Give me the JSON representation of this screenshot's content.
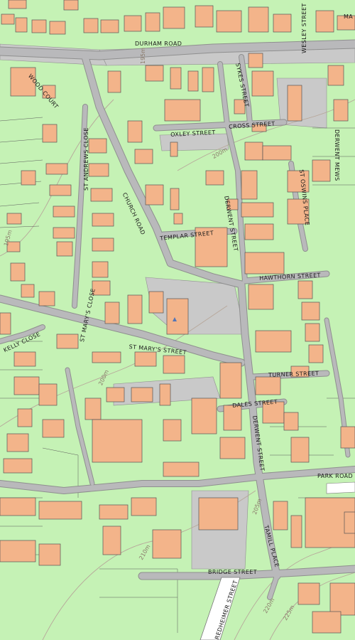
{
  "map": {
    "colors": {
      "land": "#c5f2b5",
      "road": "#b9b9bb",
      "building": "#f3b48a",
      "paved": "#c9c9c9",
      "contour": "#b7a79a",
      "marker": "#5575b5"
    },
    "streets": {
      "durham_road": "DURHAM ROAD",
      "wesley_street": "WESLEY STREET",
      "ma_partial": "MA",
      "oxley_street": "OXLEY STREET",
      "cross_street": "CROSS STREET",
      "sykes_street": "SYKES STREET",
      "derwent_mews": "DERWENT MEWS",
      "st_andrews_close": "ST ANDREWS CLOSE",
      "wood_court": "WOOD COURT",
      "church_road": "CHURCH ROAD",
      "templar_street": "TEMPLAR STREET",
      "derwent_street_upper": "DERWENT STREET",
      "st_oswins_place": "ST OSWINS PLACE",
      "hawthorn_street": "HAWTHORN STREET",
      "st_marys_close": "ST MARY'S CLOSE",
      "kelly_close": "KELLY CLOSE",
      "st_marys_street": "ST MARY'S STREET",
      "turner_street": "TURNER STREET",
      "dales_street": "DALES STREET",
      "derwent_street_lower": "DERWENT STREET",
      "park_road": "PARK ROAD",
      "tamil_place": "TAMILL PLACE",
      "bridge_street": "BRIDGE STREET",
      "redheimer_street": "REDHEIMER STREET"
    },
    "contours": {
      "c195_top": "195m",
      "c195_left": "195m",
      "c200_upper": "200m",
      "c200_mid": "200m",
      "c205": "205m",
      "c210": "210m",
      "c220_lower": "220m",
      "c225": "225m"
    }
  }
}
